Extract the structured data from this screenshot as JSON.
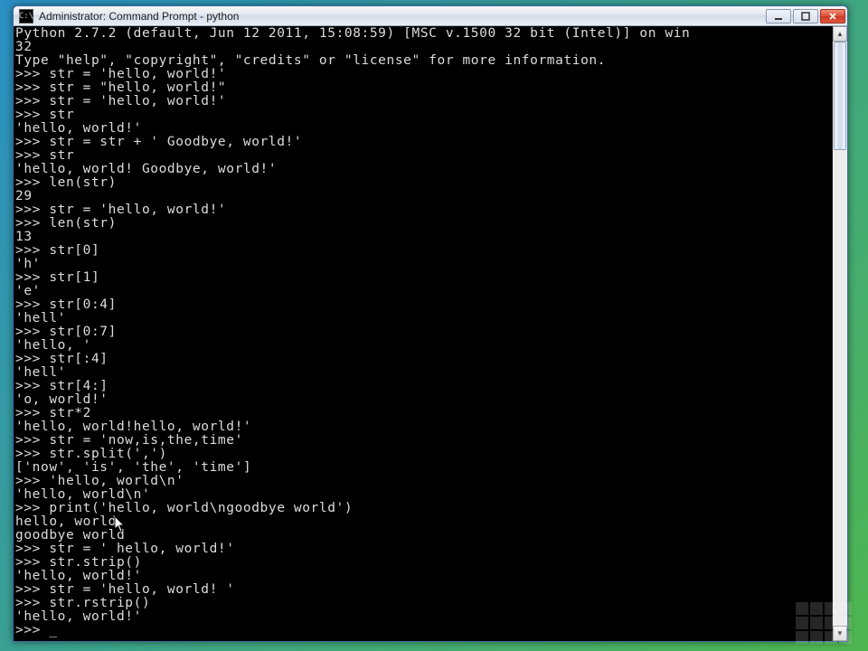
{
  "window": {
    "title": "Administrator: Command Prompt - python"
  },
  "terminal": {
    "lines": [
      "Python 2.7.2 (default, Jun 12 2011, 15:08:59) [MSC v.1500 32 bit (Intel)] on win",
      "32",
      "Type \"help\", \"copyright\", \"credits\" or \"license\" for more information.",
      ">>> str = 'hello, world!'",
      ">>> str = \"hello, world!\"",
      ">>> str = 'hello, world!'",
      ">>> str",
      "'hello, world!'",
      ">>> str = str + ' Goodbye, world!'",
      ">>> str",
      "'hello, world! Goodbye, world!'",
      ">>> len(str)",
      "29",
      ">>> str = 'hello, world!'",
      ">>> len(str)",
      "13",
      ">>> str[0]",
      "'h'",
      ">>> str[1]",
      "'e'",
      ">>> str[0:4]",
      "'hell'",
      ">>> str[0:7]",
      "'hello, '",
      ">>> str[:4]",
      "'hell'",
      ">>> str[4:]",
      "'o, world!'",
      ">>> str*2",
      "'hello, world!hello, world!'",
      ">>> str = 'now,is,the,time'",
      ">>> str.split(',')",
      "['now', 'is', 'the', 'time']",
      ">>> 'hello, world\\n'",
      "'hello, world\\n'",
      ">>> print('hello, world\\ngoodbye world')",
      "hello, world",
      "goodbye world",
      ">>> str = ' hello, world!'",
      ">>> str.strip()",
      "'hello, world!'",
      ">>> str = 'hello, world! '",
      ">>> str.rstrip()",
      "'hello, world!'",
      ">>> "
    ],
    "cursor": "_"
  },
  "icons": {
    "minimize": "minimize-icon",
    "maximize": "maximize-icon",
    "close": "close-icon",
    "scroll_up": "▲",
    "scroll_down": "▼"
  }
}
